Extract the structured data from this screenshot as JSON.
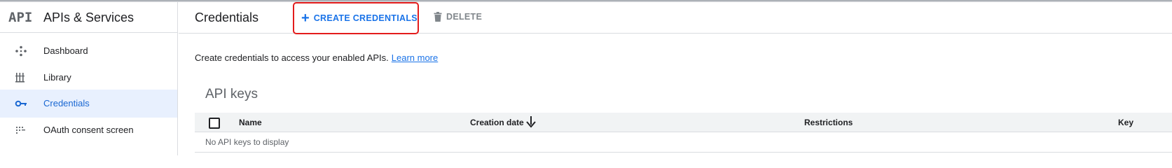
{
  "brand": {
    "logo": "API",
    "title": "APIs & Services"
  },
  "sidebar": {
    "items": [
      {
        "label": "Dashboard",
        "icon": "dashboard-icon",
        "active": false
      },
      {
        "label": "Library",
        "icon": "library-icon",
        "active": false
      },
      {
        "label": "Credentials",
        "icon": "key-icon",
        "active": true
      },
      {
        "label": "OAuth consent screen",
        "icon": "oauth-consent-icon",
        "active": false
      }
    ]
  },
  "header": {
    "title": "Credentials",
    "create_label": "CREATE CREDENTIALS",
    "delete_label": "DELETE"
  },
  "main": {
    "intro_text": "Create credentials to access your enabled APIs.",
    "learn_more": "Learn more",
    "section_title": "API keys",
    "table": {
      "columns": [
        "Name",
        "Creation date",
        "Restrictions",
        "Key"
      ],
      "empty_text": "No API keys to display"
    }
  },
  "colors": {
    "accent": "#1a73e8",
    "active_bg": "#e8f0fe",
    "highlight": "#e31c1c"
  }
}
